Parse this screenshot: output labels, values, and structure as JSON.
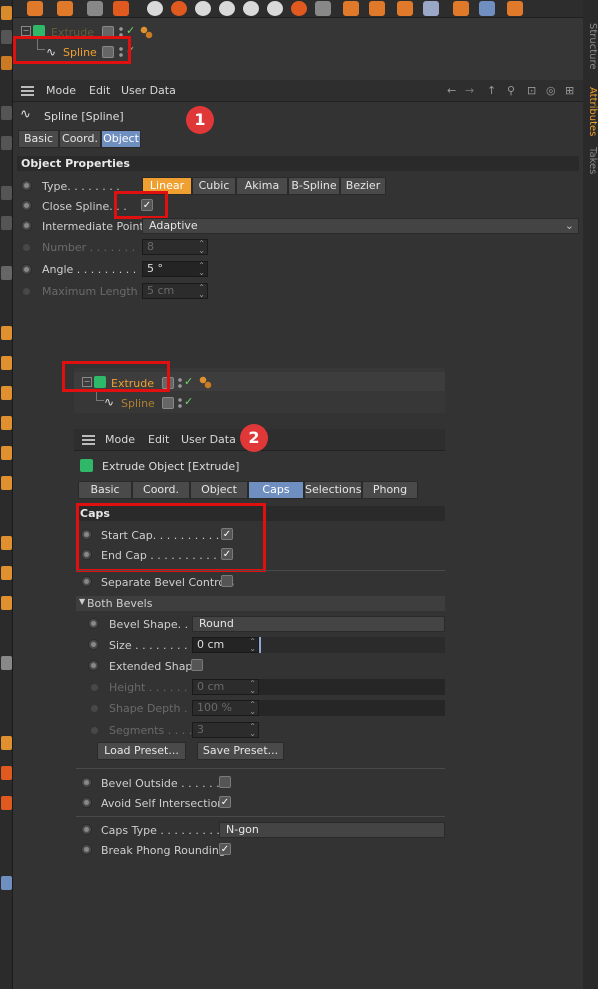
{
  "right_tabs": [
    "Structure",
    "Attributes",
    "Takes"
  ],
  "top_manager": {
    "items": [
      {
        "name": "Extrude"
      },
      {
        "name": "Spline"
      }
    ]
  },
  "panel1": {
    "menu": [
      "Mode",
      "Edit",
      "User Data"
    ],
    "object_title": "Spline [Spline]",
    "tabs": [
      "Basic",
      "Coord.",
      "Object"
    ],
    "section": "Object Properties",
    "type_label": "Type. . . . . . . .",
    "type_options": [
      "Linear",
      "Cubic",
      "Akima",
      "B-Spline",
      "Bezier"
    ],
    "close_spline_label": "Close Spline. . .",
    "interp_label": "Intermediate Points",
    "interp_value": "Adaptive",
    "number_label": "Number . . . . . . .",
    "number_value": "8",
    "angle_label": "Angle . . . . . . . . .",
    "angle_value": "5 °",
    "maxlen_label": "Maximum Length",
    "maxlen_value": "5 cm",
    "badge": "1"
  },
  "panel2": {
    "manager_items": [
      {
        "name": "Extrude"
      },
      {
        "name": "Spline"
      }
    ],
    "menu": [
      "Mode",
      "Edit",
      "User Data"
    ],
    "object_title": "Extrude Object [Extrude]",
    "tabs": [
      "Basic",
      "Coord.",
      "Object",
      "Caps",
      "Selections",
      "Phong"
    ],
    "section": "Caps",
    "start_cap": "Start Cap. . . . . . . . . .",
    "end_cap": "End Cap . . . . . . . . . .",
    "separate_bevel": "Separate Bevel Controls",
    "both_bevels": "Both Bevels",
    "bevel_shape_label": "Bevel Shape. . .",
    "bevel_shape_value": "Round",
    "size_label": "Size . . . . . . . . .",
    "size_value": "0 cm",
    "extended_shape": "Extended Shape",
    "height_label": "Height . . . . . .",
    "height_value": "0 cm",
    "shape_depth_label": "Shape Depth . .",
    "shape_depth_value": "100 %",
    "segments_label": "Segments . . . .",
    "segments_value": "3",
    "load_preset": "Load Preset...",
    "save_preset": "Save Preset...",
    "bevel_outside": "Bevel Outside . . . . . .",
    "avoid_self": "Avoid Self Intersections",
    "caps_type_label": "Caps Type . . . . . . . . .",
    "caps_type_value": "N-gon",
    "break_phong": "Break Phong Rounding",
    "badge": "2"
  },
  "colors": {
    "accent_orange": "#f0a030",
    "selected_tab": "#6e8fbf",
    "highlight_red": "#e01010"
  }
}
